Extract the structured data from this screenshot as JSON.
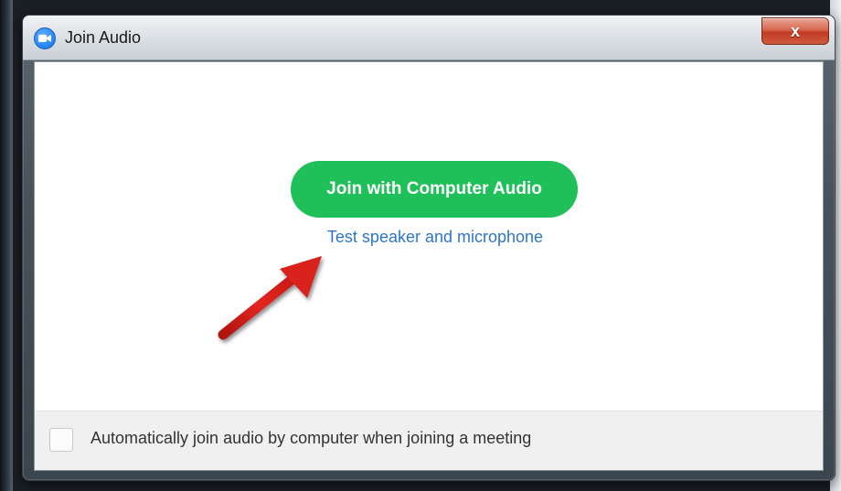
{
  "window": {
    "title": "Join Audio",
    "close_label": "x"
  },
  "main": {
    "join_button_label": "Join with Computer Audio",
    "test_link_label": "Test speaker and microphone"
  },
  "footer": {
    "checkbox_label": "Automatically join audio by computer when joining a meeting",
    "checkbox_checked": false
  },
  "colors": {
    "join_button": "#1fc05a",
    "link": "#2d75c9",
    "arrow": "#d9211c",
    "close_button": "#c23b22",
    "app_icon": "#2d8cff"
  },
  "icons": {
    "app": "zoom-camera-icon",
    "close": "close-icon",
    "annotation": "red-arrow-icon"
  }
}
